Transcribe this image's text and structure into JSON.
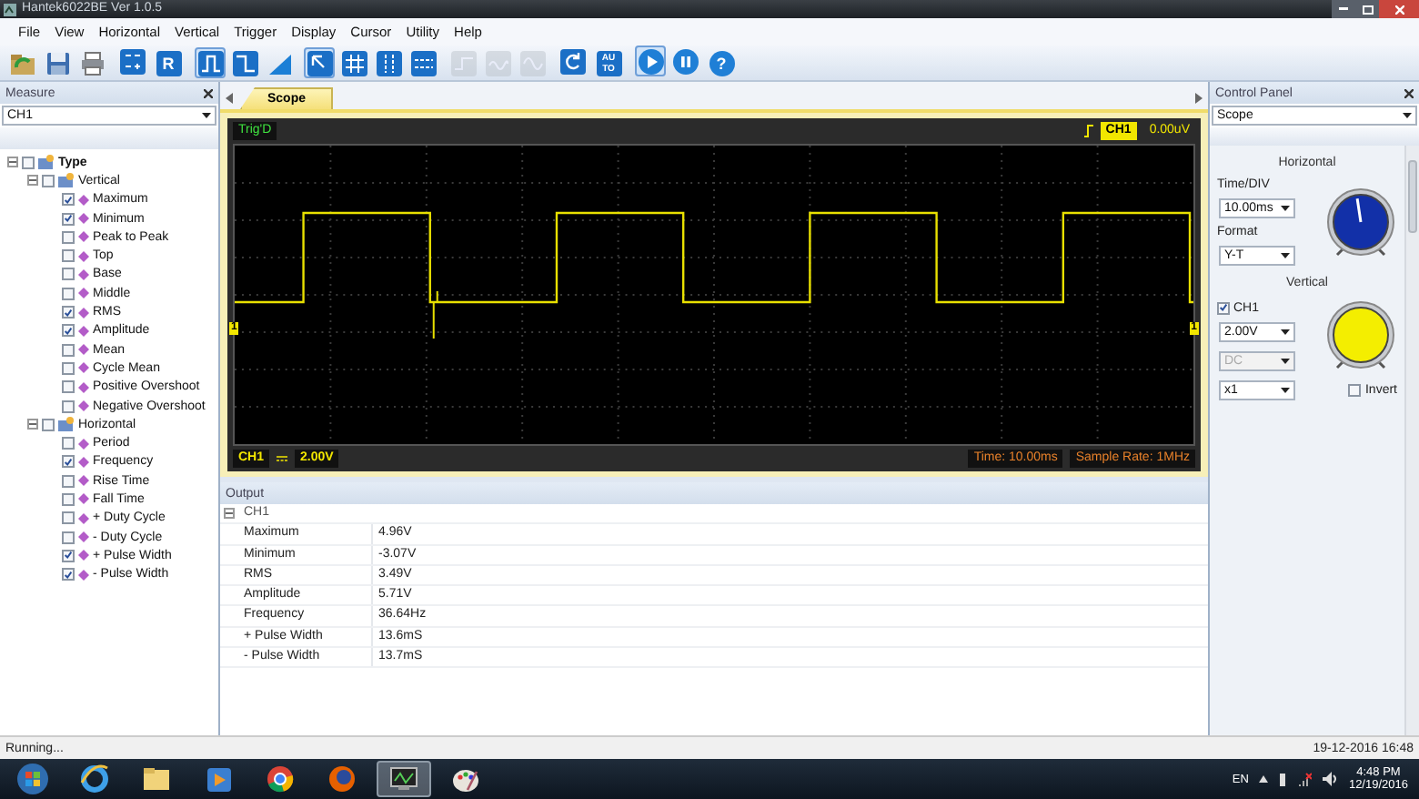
{
  "window": {
    "title": "Hantek6022BE Ver 1.0.5"
  },
  "menu": [
    "File",
    "View",
    "Horizontal",
    "Vertical",
    "Trigger",
    "Display",
    "Cursor",
    "Utility",
    "Help"
  ],
  "toolbar": [
    [
      {
        "kind": "open",
        "selected": false,
        "disabled": false
      },
      {
        "kind": "save",
        "selected": false,
        "disabled": false
      },
      {
        "kind": "print",
        "selected": false,
        "disabled": false
      }
    ],
    [
      {
        "kind": "math",
        "selected": false,
        "disabled": false
      },
      {
        "kind": "ref",
        "label": "R",
        "selected": false,
        "disabled": false
      }
    ],
    [
      {
        "kind": "pulse",
        "selected": true,
        "disabled": false
      },
      {
        "kind": "fall",
        "selected": false,
        "disabled": false
      },
      {
        "kind": "ramp",
        "selected": false,
        "disabled": false
      }
    ],
    [
      {
        "kind": "pointer",
        "selected": true,
        "disabled": false
      },
      {
        "kind": "cross",
        "selected": false,
        "disabled": false
      },
      {
        "kind": "vcursor",
        "selected": false,
        "disabled": false
      },
      {
        "kind": "hcursor",
        "selected": false,
        "disabled": false
      }
    ],
    [
      {
        "kind": "step",
        "selected": false,
        "disabled": true
      },
      {
        "kind": "wave",
        "selected": false,
        "disabled": true
      },
      {
        "kind": "sine",
        "selected": false,
        "disabled": true
      }
    ],
    [
      {
        "kind": "refresh",
        "selected": false,
        "disabled": false
      },
      {
        "kind": "auto",
        "label": "AU TO",
        "selected": false,
        "disabled": false
      }
    ],
    [
      {
        "kind": "play",
        "selected": true,
        "disabled": false
      },
      {
        "kind": "pause",
        "selected": false,
        "disabled": false
      },
      {
        "kind": "help",
        "label": "?",
        "selected": false,
        "disabled": false
      }
    ]
  ],
  "measure_panel": {
    "title": "Measure",
    "channel": "CH1",
    "tree": {
      "label": "Type",
      "checked": false,
      "expanded": true,
      "children": [
        {
          "label": "Vertical",
          "checked": false,
          "expanded": true,
          "children": [
            {
              "label": "Maximum",
              "checked": true
            },
            {
              "label": "Minimum",
              "checked": true
            },
            {
              "label": "Peak to Peak",
              "checked": false
            },
            {
              "label": "Top",
              "checked": false
            },
            {
              "label": "Base",
              "checked": false
            },
            {
              "label": "Middle",
              "checked": false
            },
            {
              "label": "RMS",
              "checked": true
            },
            {
              "label": "Amplitude",
              "checked": true
            },
            {
              "label": "Mean",
              "checked": false
            },
            {
              "label": "Cycle Mean",
              "checked": false
            },
            {
              "label": "Positive Overshoot",
              "checked": false
            },
            {
              "label": "Negative Overshoot",
              "checked": false
            }
          ]
        },
        {
          "label": "Horizontal",
          "checked": false,
          "expanded": true,
          "children": [
            {
              "label": "Period",
              "checked": false
            },
            {
              "label": "Frequency",
              "checked": true
            },
            {
              "label": "Rise Time",
              "checked": false
            },
            {
              "label": "Fall Time",
              "checked": false
            },
            {
              "label": "+ Duty Cycle",
              "checked": false
            },
            {
              "label": "- Duty Cycle",
              "checked": false
            },
            {
              "label": "+ Pulse Width",
              "checked": true
            },
            {
              "label": "- Pulse Width",
              "checked": true
            }
          ]
        }
      ]
    }
  },
  "scope_tab": {
    "label": "Scope",
    "selected": true
  },
  "scope": {
    "trigger_status": "Trig'D",
    "trigger_channel": "CH1",
    "trigger_level": "0.00uV",
    "channel_marker": "1",
    "trigger_marker": "1",
    "channel_label": "CH1",
    "volts": "2.00V",
    "time": "Time: 10.00ms",
    "sample_rate": "Sample Rate: 1MHz"
  },
  "output": {
    "title": "Output",
    "group": "CH1",
    "expanded": true,
    "rows": [
      {
        "name": "Maximum",
        "value": "4.96V"
      },
      {
        "name": "Minimum",
        "value": "-3.07V"
      },
      {
        "name": "RMS",
        "value": "3.49V"
      },
      {
        "name": "Amplitude",
        "value": "5.71V"
      },
      {
        "name": "Frequency",
        "value": "36.64Hz"
      },
      {
        "name": "+ Pulse Width",
        "value": "13.6mS"
      },
      {
        "name": "- Pulse Width",
        "value": "13.7mS"
      }
    ]
  },
  "control_panel": {
    "title": "Control Panel",
    "mode": "Scope",
    "horizontal": {
      "title": "Horizontal",
      "time_div_label": "Time/DIV",
      "time_div": "10.00ms",
      "format_label": "Format",
      "format": "Y-T"
    },
    "vertical": {
      "title": "Vertical",
      "channel": "CH1",
      "channel_on": true,
      "volts": "2.00V",
      "coupling": "DC",
      "coupling_disabled": true,
      "probe": "x1",
      "invert_label": "Invert",
      "invert": false
    }
  },
  "status_bar": {
    "text": "Running...",
    "datetime": "19-12-2016 16:48"
  },
  "taskbar": {
    "language": "EN",
    "time": "4:48 PM",
    "date": "12/19/2016",
    "apps": [
      {
        "kind": "ie",
        "active": false
      },
      {
        "kind": "folder",
        "active": false
      },
      {
        "kind": "media",
        "active": false
      },
      {
        "kind": "chrome",
        "active": false
      },
      {
        "kind": "firefox",
        "active": false
      },
      {
        "kind": "scope",
        "active": true
      },
      {
        "kind": "paint",
        "active": false
      }
    ]
  }
}
